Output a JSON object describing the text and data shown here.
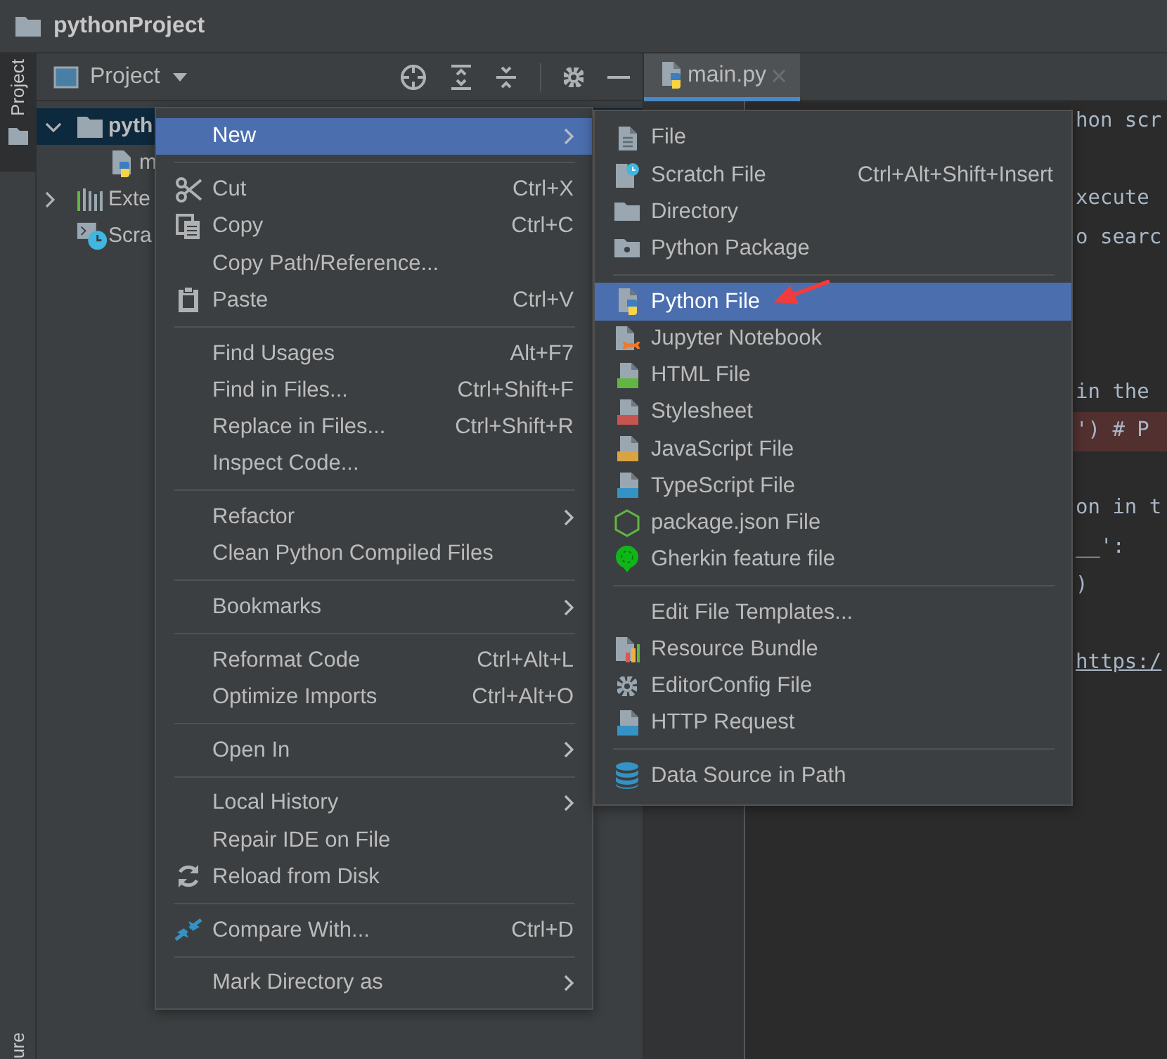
{
  "window": {
    "title": "pythonProject"
  },
  "side_stripe": {
    "top_label": "Project",
    "bottom_label": "ure"
  },
  "project_panel": {
    "view": "Project",
    "tree": [
      {
        "label": "pyth",
        "kind": "folder",
        "expanded": true,
        "selected": true,
        "children": [
          {
            "label": "m",
            "kind": "python",
            "selected": false
          }
        ]
      },
      {
        "label": "Exte",
        "kind": "library",
        "expanded": false,
        "selected": false
      },
      {
        "label": "Scra",
        "kind": "scratch",
        "selected": false
      }
    ]
  },
  "editor": {
    "tabs": [
      {
        "label": "main.py",
        "selected": true
      }
    ],
    "lines": [
      {
        "kind": "code",
        "text": "hon scr",
        "highlighted": false
      },
      {
        "kind": "blank"
      },
      {
        "kind": "code",
        "text": "xecute",
        "highlighted": false
      },
      {
        "kind": "code",
        "text": "o searc",
        "highlighted": false
      },
      {
        "kind": "blank"
      },
      {
        "kind": "blank"
      },
      {
        "kind": "blank"
      },
      {
        "kind": "code",
        "text": "in the",
        "highlighted": false
      },
      {
        "kind": "code",
        "text": "')  # P",
        "highlighted": true
      },
      {
        "kind": "blank"
      },
      {
        "kind": "code",
        "text": "on in t",
        "highlighted": false
      },
      {
        "kind": "code",
        "text": "__':",
        "highlighted": false
      },
      {
        "kind": "code",
        "text": ")",
        "highlighted": false
      },
      {
        "kind": "blank"
      },
      {
        "kind": "link",
        "text": "https:/",
        "highlighted": false
      }
    ]
  },
  "context_menu": {
    "items": [
      {
        "kind": "plain",
        "label": "New",
        "has_submenu": true,
        "selected": true
      },
      {
        "kind": "separator"
      },
      {
        "kind": "cut",
        "label": "Cut",
        "shortcut": "Ctrl+X",
        "has_submenu": false,
        "selected": false
      },
      {
        "kind": "copy",
        "label": "Copy",
        "shortcut": "Ctrl+C",
        "has_submenu": false,
        "selected": false
      },
      {
        "kind": "plain",
        "label": "Copy Path/Reference...",
        "has_submenu": false,
        "selected": false
      },
      {
        "kind": "paste",
        "label": "Paste",
        "shortcut": "Ctrl+V",
        "has_submenu": false,
        "selected": false
      },
      {
        "kind": "separator"
      },
      {
        "kind": "plain",
        "label": "Find Usages",
        "shortcut": "Alt+F7",
        "has_submenu": false,
        "selected": false
      },
      {
        "kind": "plain",
        "label": "Find in Files...",
        "shortcut": "Ctrl+Shift+F",
        "has_submenu": false,
        "selected": false
      },
      {
        "kind": "plain",
        "label": "Replace in Files...",
        "shortcut": "Ctrl+Shift+R",
        "has_submenu": false,
        "selected": false
      },
      {
        "kind": "plain",
        "label": "Inspect Code...",
        "has_submenu": false,
        "selected": false
      },
      {
        "kind": "separator"
      },
      {
        "kind": "plain",
        "label": "Refactor",
        "has_submenu": true,
        "selected": false
      },
      {
        "kind": "plain",
        "label": "Clean Python Compiled Files",
        "has_submenu": false,
        "selected": false
      },
      {
        "kind": "separator"
      },
      {
        "kind": "plain",
        "label": "Bookmarks",
        "has_submenu": true,
        "selected": false
      },
      {
        "kind": "separator"
      },
      {
        "kind": "plain",
        "label": "Reformat Code",
        "shortcut": "Ctrl+Alt+L",
        "has_submenu": false,
        "selected": false
      },
      {
        "kind": "plain",
        "label": "Optimize Imports",
        "shortcut": "Ctrl+Alt+O",
        "has_submenu": false,
        "selected": false
      },
      {
        "kind": "separator"
      },
      {
        "kind": "plain",
        "label": "Open In",
        "has_submenu": true,
        "selected": false
      },
      {
        "kind": "separator"
      },
      {
        "kind": "plain",
        "label": "Local History",
        "has_submenu": true,
        "selected": false
      },
      {
        "kind": "plain",
        "label": "Repair IDE on File",
        "has_submenu": false,
        "selected": false
      },
      {
        "kind": "reload",
        "label": "Reload from Disk",
        "has_submenu": false,
        "selected": false
      },
      {
        "kind": "separator"
      },
      {
        "kind": "compare",
        "label": "Compare With...",
        "shortcut": "Ctrl+D",
        "has_submenu": false,
        "selected": false
      },
      {
        "kind": "separator"
      },
      {
        "kind": "plain",
        "label": "Mark Directory as",
        "has_submenu": true,
        "selected": false
      }
    ]
  },
  "new_submenu": {
    "items": [
      {
        "kind": "file",
        "label": "File",
        "selected": false
      },
      {
        "kind": "scratch",
        "label": "Scratch File",
        "shortcut": "Ctrl+Alt+Shift+Insert",
        "selected": false
      },
      {
        "kind": "directory",
        "label": "Directory",
        "selected": false
      },
      {
        "kind": "package",
        "label": "Python Package",
        "selected": false
      },
      {
        "kind": "separator"
      },
      {
        "kind": "python",
        "label": "Python File",
        "selected": true
      },
      {
        "kind": "jupyter",
        "label": "Jupyter Notebook",
        "selected": false
      },
      {
        "kind": "html",
        "label": "HTML File",
        "selected": false
      },
      {
        "kind": "css",
        "label": "Stylesheet",
        "selected": false
      },
      {
        "kind": "js",
        "label": "JavaScript File",
        "selected": false
      },
      {
        "kind": "ts",
        "label": "TypeScript File",
        "selected": false
      },
      {
        "kind": "nodejs",
        "label": "package.json File",
        "selected": false
      },
      {
        "kind": "gherkin",
        "label": "Gherkin feature file",
        "selected": false
      },
      {
        "kind": "separator"
      },
      {
        "kind": "plain",
        "label": "Edit File Templates...",
        "selected": false
      },
      {
        "kind": "resource",
        "label": "Resource Bundle",
        "selected": false
      },
      {
        "kind": "editorconfig",
        "label": "EditorConfig File",
        "selected": false
      },
      {
        "kind": "http",
        "label": "HTTP Request",
        "selected": false
      },
      {
        "kind": "separator"
      },
      {
        "kind": "database",
        "label": "Data Source in Path",
        "selected": false
      }
    ]
  }
}
